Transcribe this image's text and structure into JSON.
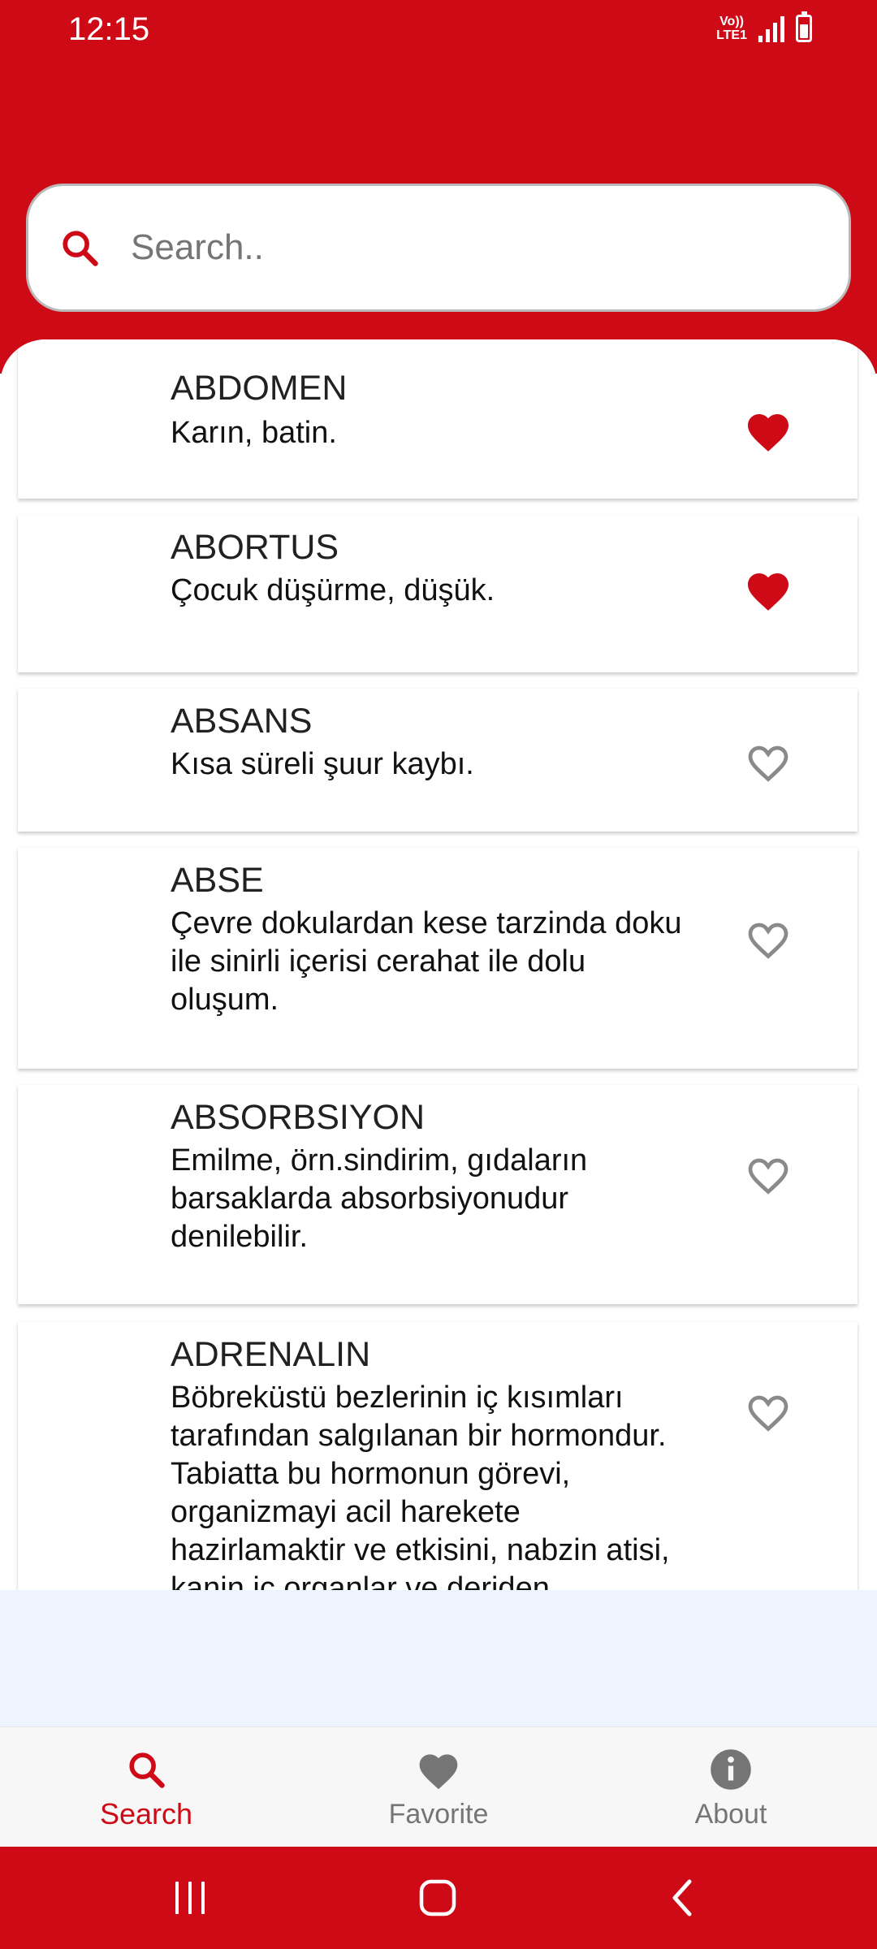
{
  "status_bar": {
    "time": "12:15",
    "network_line1": "Vo))",
    "network_line2": "LTE1"
  },
  "search": {
    "placeholder": "Search.."
  },
  "entries": [
    {
      "term": "ABDOMEN",
      "description": " Karın, batin.",
      "favorite": true
    },
    {
      "term": "ABORTUS",
      "description": " Çocuk düşürme, düşük.",
      "favorite": true
    },
    {
      "term": "ABSANS",
      "description": " Kısa süreli şuur kaybı.",
      "favorite": false
    },
    {
      "term": "ABSE",
      "description": " Çevre dokulardan kese tarzinda doku ile sinirli içerisi cerahat ile dolu oluşum.",
      "favorite": false
    },
    {
      "term": "ABSORBSIYON",
      "description": " Emilme, örn.sindirim, gıdaların barsaklarda absorbsiyonudur denilebilir.",
      "favorite": false
    },
    {
      "term": "ADRENALIN",
      "description": " Böbreküstü bezlerinin iç kısımları tarafından salgılanan bir hormondur. Tabiatta bu hormonun görevi, organizmayi acil harekete hazirlamaktir ve etkisini, nabzin atisi, kanin iç organlar ve deriden",
      "favorite": false
    }
  ],
  "bottom_nav": [
    {
      "label": "Search",
      "icon": "search-icon",
      "active": true
    },
    {
      "label": "Favorite",
      "icon": "heart-icon",
      "active": false
    },
    {
      "label": "About",
      "icon": "info-icon",
      "active": false
    }
  ],
  "colors": {
    "primary": "#cf0a17",
    "heart_filled": "#cf0a17",
    "heart_outline": "#8a8a8a",
    "inactive": "#757575"
  }
}
